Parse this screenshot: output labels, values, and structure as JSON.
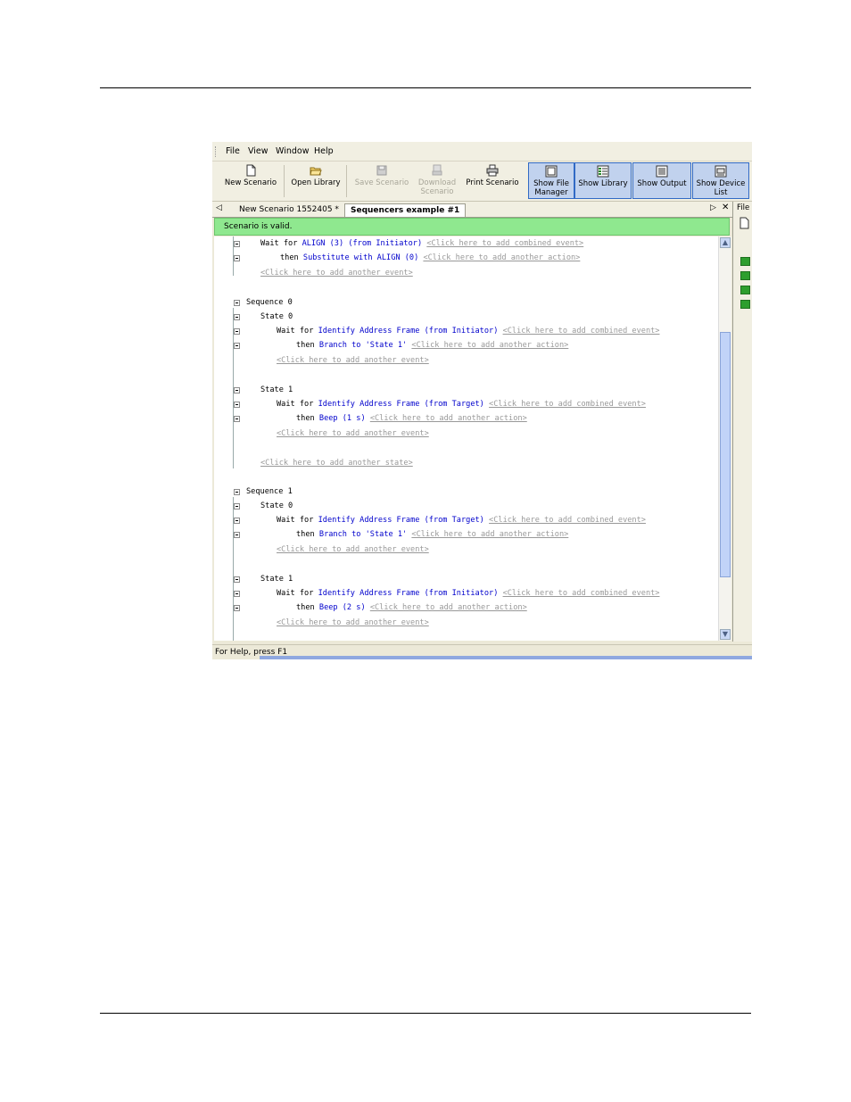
{
  "menu": {
    "file": "File",
    "view": "View",
    "window": "Window",
    "help": "Help"
  },
  "toolbar": {
    "new_scenario": "New Scenario",
    "open_library": "Open Library",
    "save_scenario": "Save Scenario",
    "download_scenario": "Download Scenario",
    "print_scenario": "Print Scenario",
    "show_file_manager": "Show File Manager",
    "show_library": "Show Library",
    "show_output": "Show Output",
    "show_device_list": "Show Device List"
  },
  "tabs": [
    {
      "label": "New Scenario 1552405 *"
    },
    {
      "label": "Sequencers example #1"
    }
  ],
  "right_panel": {
    "title": "File"
  },
  "validation": "Scenario is valid.",
  "code": [
    {
      "w1": "Wait for",
      "ev": "ALIGN (3) (from Initiator)",
      "lk": "<Click here to add combined event>"
    },
    {
      "w1": "then",
      "act": "Substitute with ALIGN (0)",
      "lk": "<Click here to add another action>"
    },
    {
      "lk": "<Click here to add another event>"
    },
    {
      "seq": "Sequence 0"
    },
    {
      "st": "State 0"
    },
    {
      "w1": "Wait for",
      "ev": "Identify Address Frame (from Initiator)",
      "lk": "<Click here to add combined event>"
    },
    {
      "w1": "then",
      "act": "Branch to 'State 1'",
      "lk": "<Click here to add another action>"
    },
    {
      "lk": "<Click here to add another event>"
    },
    {
      "st": "State 1"
    },
    {
      "w1": "Wait for",
      "ev": "Identify Address Frame (from Target)",
      "lk": "<Click here to add combined event>"
    },
    {
      "w1": "then",
      "act": "Beep (1 s)",
      "lk": "<Click here to add another action>"
    },
    {
      "lk": "<Click here to add another event>"
    },
    {
      "lk": "<Click here to add another state>"
    },
    {
      "seq": "Sequence 1"
    },
    {
      "st": "State 0"
    },
    {
      "w1": "Wait for",
      "ev": "Identify Address Frame (from Target)",
      "lk": "<Click here to add combined event>"
    },
    {
      "w1": "then",
      "act": "Branch to 'State 1'",
      "lk": "<Click here to add another action>"
    },
    {
      "lk": "<Click here to add another event>"
    },
    {
      "st": "State 1"
    },
    {
      "w1": "Wait for",
      "ev": "Identify Address Frame (from Initiator)",
      "lk": "<Click here to add combined event>"
    },
    {
      "w1": "then",
      "act": "Beep (2 s)",
      "lk": "<Click here to add another action>"
    },
    {
      "lk": "<Click here to add another event>"
    }
  ],
  "statusbar": "For Help, press F1"
}
